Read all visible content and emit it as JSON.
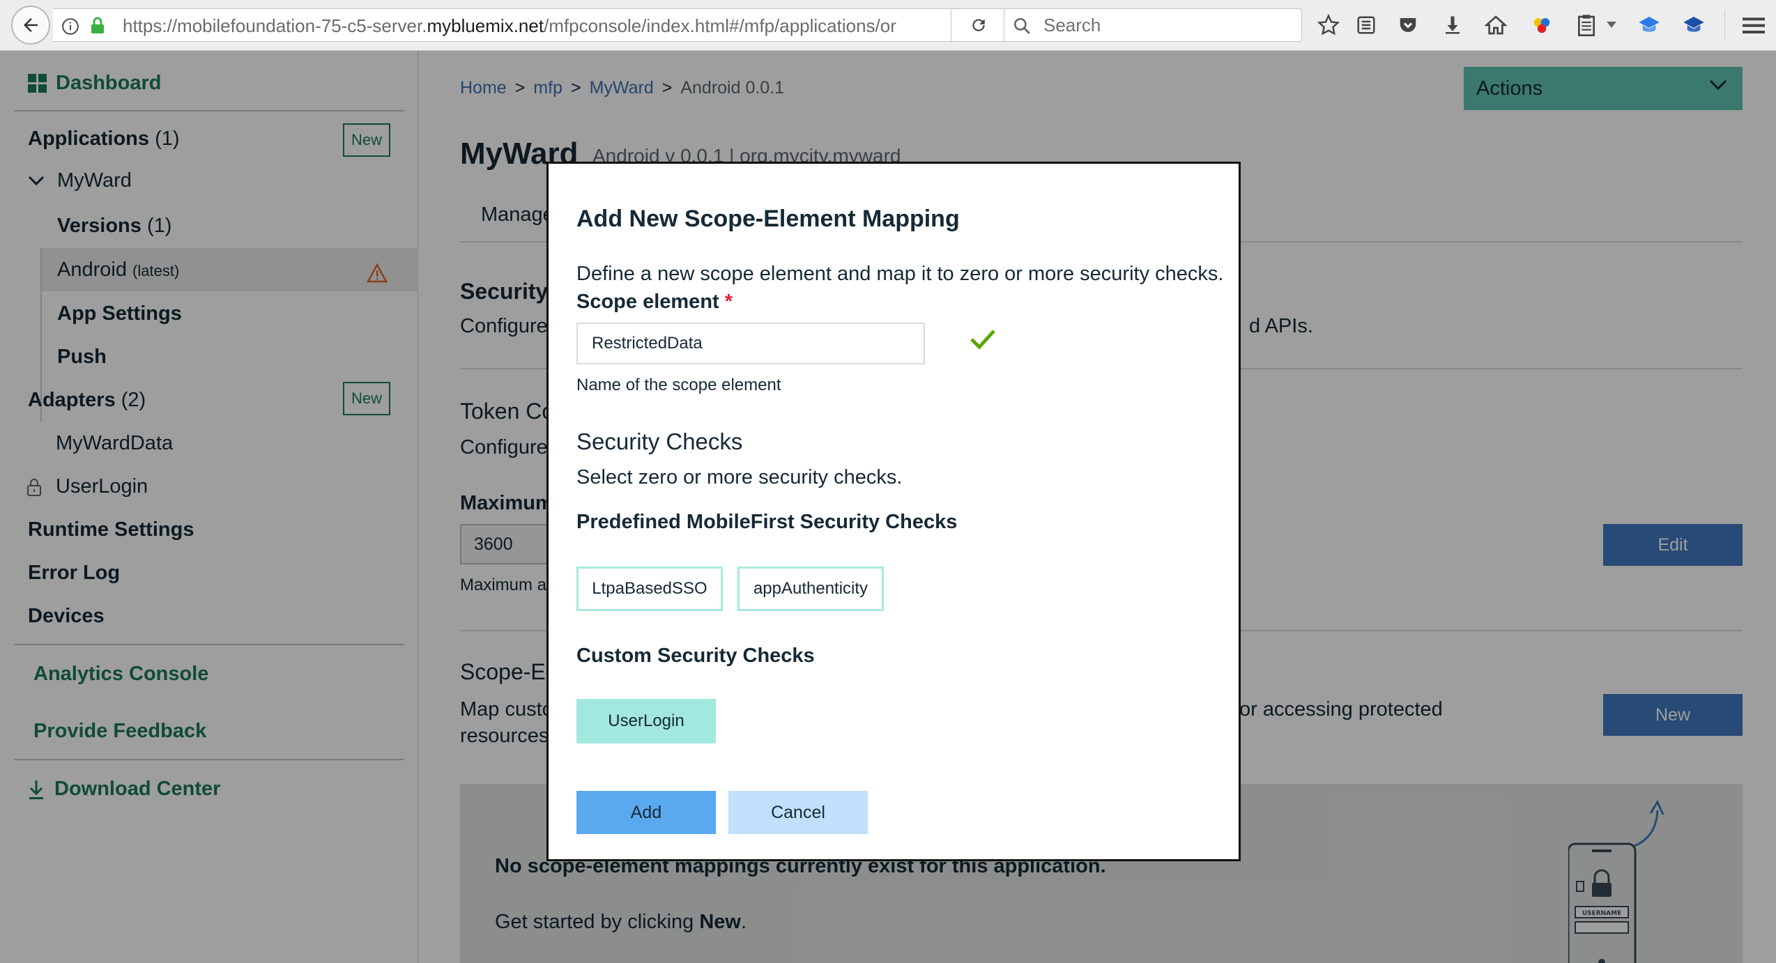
{
  "browser": {
    "url_prefix": "https://mobilefoundation-75-c5-server.",
    "url_domain": "mybluemix.net",
    "url_path": "/mfpconsole/index.html#/mfp/applications/or",
    "search_placeholder": "Search"
  },
  "sidebar": {
    "dashboard": "Dashboard",
    "applications": "Applications",
    "applications_count": "(1)",
    "new_label": "New",
    "app_name": "MyWard",
    "versions": "Versions",
    "versions_count": "(1)",
    "android": "Android",
    "android_tag": "(latest)",
    "app_settings": "App Settings",
    "push": "Push",
    "adapters": "Adapters",
    "adapters_count": "(2)",
    "adapter_1": "MyWardData",
    "adapter_2": "UserLogin",
    "runtime_settings": "Runtime Settings",
    "error_log": "Error Log",
    "devices": "Devices",
    "analytics_console": "Analytics Console",
    "provide_feedback": "Provide Feedback",
    "download_center": "Download Center"
  },
  "main": {
    "breadcrumb": [
      "Home",
      "mfp",
      "MyWard",
      "Android 0.0.1"
    ],
    "breadcrumb_sep": ">",
    "actions_label": "Actions",
    "app_title": "MyWard",
    "app_subtitle": "Android v 0.0.1 | org.mycity.myward",
    "tab_manage": "Manage",
    "security_title": "Security",
    "security_desc_left": "Configure",
    "security_desc_right": "d APIs.",
    "token_title": "Token Co",
    "token_desc": "Configure",
    "maximum_label": "Maximum",
    "token_value": "3600",
    "maximum_help": "Maximum a",
    "edit_label": "Edit",
    "scope_title": "Scope-E",
    "scope_desc_l1": "Map custo",
    "scope_desc_l2": "resources",
    "scope_desc_right": "or accessing protected",
    "new_label": "New",
    "empty_text": "No scope-element mappings currently exist for this application.",
    "get_started_prefix": "Get started by clicking ",
    "get_started_bold": "New",
    "get_started_suffix": ".",
    "illustration_label": "USERNAME"
  },
  "modal": {
    "title": "Add New Scope-Element Mapping",
    "description": "Define a new scope element and map it to zero or more security checks.",
    "scope_label": "Scope element",
    "required_mark": "*",
    "scope_value": "RestrictedData",
    "scope_help": "Name of the scope element",
    "checks_title": "Security Checks",
    "checks_desc": "Select zero or more security checks.",
    "predefined_title": "Predefined MobileFirst Security Checks",
    "predefined": [
      "LtpaBasedSSO",
      "appAuthenticity"
    ],
    "custom_title": "Custom Security Checks",
    "custom": [
      "UserLogin"
    ],
    "add_label": "Add",
    "cancel_label": "Cancel"
  },
  "colors": {
    "accent_green": "#1a7a5a",
    "actions_teal": "#5fc2b0",
    "primary_blue": "#4178be",
    "chip_selected": "#a3e8de",
    "warning": "#e0662a"
  }
}
